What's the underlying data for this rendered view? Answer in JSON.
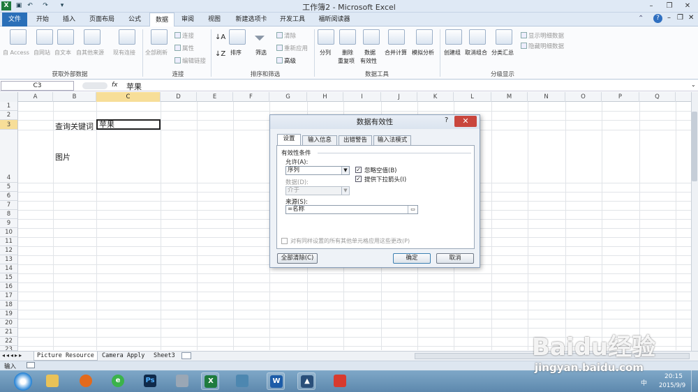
{
  "app": {
    "title": "工作簿2 - Microsoft Excel"
  },
  "tabs": [
    "文件",
    "开始",
    "插入",
    "页面布局",
    "公式",
    "数据",
    "审阅",
    "视图",
    "新建选项卡",
    "开发工具",
    "福昕阅读器"
  ],
  "ribbon": {
    "external": {
      "access": "自 Access",
      "web": "自网站",
      "text": "自文本",
      "other": "自其他来源",
      "existing": "现有连接",
      "group": "获取外部数据"
    },
    "connections": {
      "refresh": "全部刷新",
      "conn": "连接",
      "props": "属性",
      "edit": "编辑链接",
      "group": "连接"
    },
    "sort": {
      "sort": "排序",
      "filter": "筛选",
      "clear": "清除",
      "reapply": "重新应用",
      "advanced": "高级",
      "group": "排序和筛选"
    },
    "tools": {
      "split": "分列",
      "dedupe": "删除",
      "dedupe2": "重复项",
      "valid": "数据",
      "valid2": "有效性",
      "merge": "合并计算",
      "whatif": "模拟分析",
      "group": "数据工具"
    },
    "outline": {
      "group_btn": "创建组",
      "ungroup": "取消组合",
      "subtotal": "分类汇总",
      "show": "显示明细数据",
      "hide": "隐藏明细数据",
      "group": "分级显示"
    }
  },
  "formula_bar": {
    "name_box": "C3",
    "fx": "fx",
    "value": "苹果"
  },
  "columns": [
    "A",
    "B",
    "C",
    "D",
    "E",
    "F",
    "G",
    "H",
    "I",
    "J",
    "K",
    "L",
    "M",
    "N",
    "O",
    "P",
    "Q"
  ],
  "rows": [
    "1",
    "2",
    "3",
    "4",
    "5",
    "6",
    "7",
    "8",
    "9",
    "10",
    "11",
    "12",
    "13",
    "14",
    "15",
    "16",
    "17",
    "18",
    "19",
    "20",
    "21",
    "22",
    "23"
  ],
  "cells": {
    "b3": "查询关键词",
    "c3": "苹果",
    "b5": "图片"
  },
  "dialog": {
    "title": "数据有效性",
    "help": "?",
    "close": "✕",
    "tabs": [
      "设置",
      "输入信息",
      "出错警告",
      "输入法模式"
    ],
    "criteria": "有效性条件",
    "allow_label": "允许(A):",
    "allow_value": "序列",
    "ignore_blank": "忽略空值(B)",
    "dropdown": "提供下拉箭头(I)",
    "data_label": "数据(D):",
    "data_value": "介于",
    "source_label": "来源(S):",
    "source_value": "=名称",
    "apply_all": "对有同样设置的所有其他单元格应用这些更改(P)",
    "clear_all": "全部清除(C)",
    "ok": "确定",
    "cancel": "取消"
  },
  "sheets": [
    "Picture Resource",
    "Camera Apply",
    "Sheet3"
  ],
  "status": {
    "mode": "输入"
  },
  "taskbar": {
    "time": "20:15",
    "date": "2015/9/9",
    "lang": "中"
  },
  "watermark": {
    "text": "Baidu经验",
    "url": "jingyan.baidu.com"
  },
  "colors": {
    "accent": "#2a6fb8",
    "selected_header": "#f7de98",
    "close": "#c9463d"
  }
}
